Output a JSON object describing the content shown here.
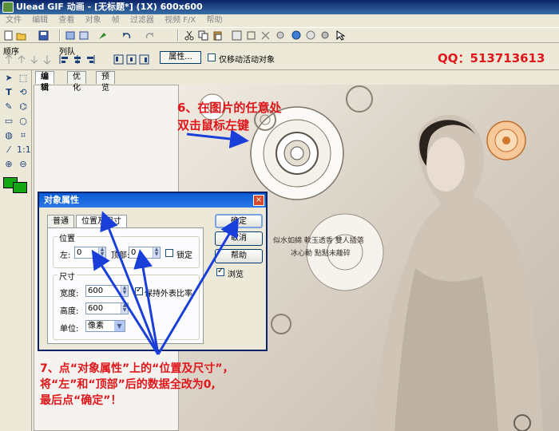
{
  "window": {
    "title": "Ulead GIF 动画 - [无标题*] (1X) 600x600"
  },
  "menu": {
    "items": [
      "文件",
      "编辑",
      "查看",
      "对象",
      "帧",
      "过滤器",
      "视频 F/X",
      "帮助"
    ]
  },
  "toolbar2": {
    "order_label": "顺序",
    "queue_label": "列队",
    "attributes_button": "属性...",
    "move_active_only_label": "仅移动活动对象"
  },
  "contact": {
    "qq": "QQ：513713613"
  },
  "tabs": [
    "编辑",
    "优化",
    "预览"
  ],
  "dialog": {
    "title": "对象属性",
    "tabs": [
      "普通",
      "位置及尺寸"
    ],
    "position_group": "位置",
    "left_label": "左:",
    "left_value": "0",
    "top_label": "顶部:",
    "top_value": "0",
    "lock_label": "锁定",
    "size_group": "尺寸",
    "width_label": "宽度:",
    "width_value": "600",
    "height_label": "高度:",
    "height_value": "600",
    "keep_ratio_label": "保持外表比率",
    "unit_label": "单位:",
    "unit_value": "像素",
    "ok_button": "确定",
    "cancel_button": "取消",
    "help_button": "帮助",
    "browse_label": "浏览"
  },
  "canvas": {
    "poem_line1": "似水如綿 軟玉透香 雙人插落",
    "poem_line2": "冰心動 點點未離碎"
  },
  "annotations": {
    "step6_line1": "6、在图片的任意处",
    "step6_line2": "双击鼠标左键",
    "step7_line1": "7、点“对象属性”上的“位置及尺寸”，",
    "step7_line2": "将“左”和“顶部”后的数据全改为0,",
    "step7_line3": "最后点“确定”！"
  },
  "colors": {
    "annotation": "#e0161b",
    "arrow": "#1a3fd9",
    "swatch": "#13a813"
  }
}
